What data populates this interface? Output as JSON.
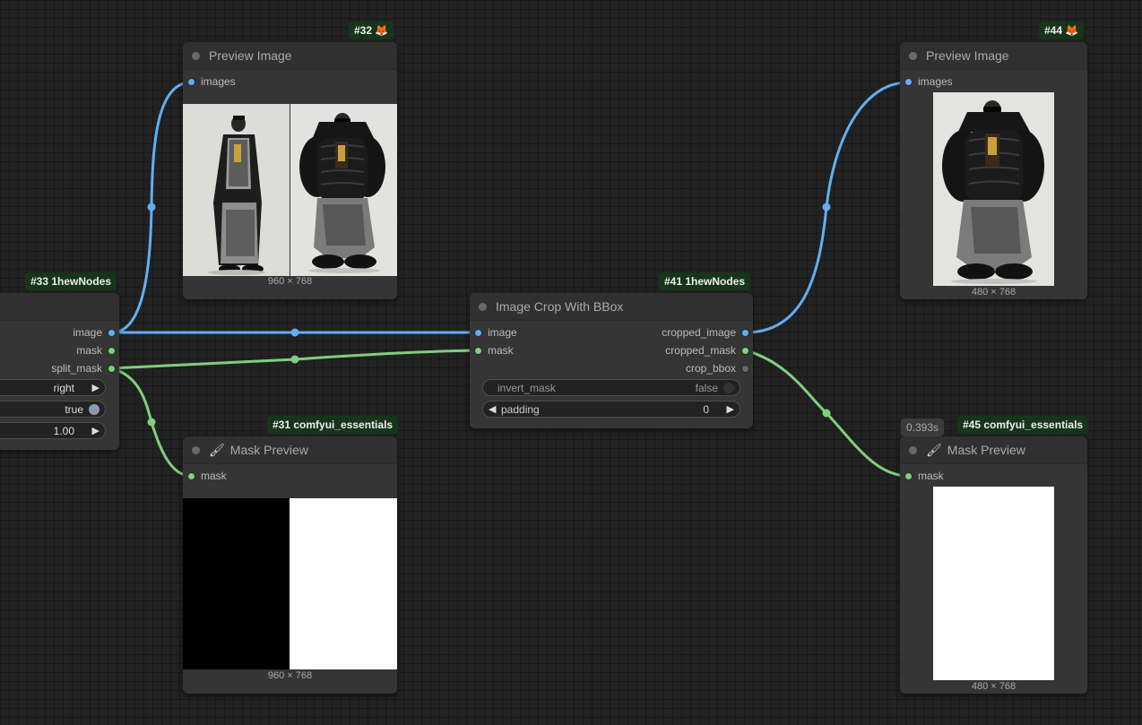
{
  "colors": {
    "image_wire": "#62aef0",
    "mask_wire": "#7fcf7d",
    "badge_bg": "#16351b",
    "background": "#222222",
    "node_bg": "#353535"
  },
  "node33": {
    "badge": "#33 1hewNodes",
    "outputs": [
      "image",
      "mask",
      "split_mask"
    ],
    "widget_values": [
      "right",
      "true",
      "1.00"
    ]
  },
  "node32": {
    "badge": "#32",
    "badge_icon": "fox-icon",
    "title": "Preview Image",
    "input": "images",
    "dims": "960 × 768"
  },
  "node31": {
    "badge": "#31 comfyui_essentials",
    "title": "Mask Preview",
    "title_icon": "brush-icon",
    "input": "mask",
    "dims": "960 × 768"
  },
  "node41": {
    "badge": "#41 1hewNodes",
    "title": "Image Crop With BBox",
    "inputs": [
      "image",
      "mask"
    ],
    "outputs": [
      "cropped_image",
      "cropped_mask",
      "crop_bbox"
    ],
    "invert_mask": {
      "label": "invert_mask",
      "value": "false"
    },
    "padding": {
      "label": "padding",
      "value": "0"
    }
  },
  "node44": {
    "badge": "#44",
    "badge_icon": "fox-icon",
    "title": "Preview Image",
    "input": "images",
    "dims": "480 × 768"
  },
  "node45": {
    "badge": "#45 comfyui_essentials",
    "time": "0.393s",
    "title": "Mask Preview",
    "title_icon": "brush-icon",
    "input": "mask",
    "dims": "480 × 768"
  }
}
